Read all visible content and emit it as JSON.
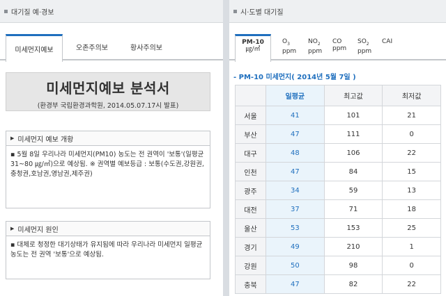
{
  "left": {
    "section_title": "대기질 예·경보",
    "tabs": [
      {
        "label": "미세먼지예보"
      },
      {
        "label": "오존주의보"
      },
      {
        "label": "황사주의보"
      }
    ],
    "report_title": "미세먼지예보 분석서",
    "report_subtitle": "(환경부 국립환경과학원, 2014.05.07.17시 발표)",
    "overview": {
      "heading": "미세먼지 예보 개황",
      "text": "▪ 5월 8일 우리나라 미세먼지(PM10) 농도는 전 권역이 '보통'(일평균 31~80 ㎍/㎥)으로 예상됨. ※ 권역별 예보등급 : 보통(수도권,강원권,충청권,호남권,영남권,제주권)"
    },
    "cause": {
      "heading": "미세먼지 원인",
      "text": "▪ 대체로 청정한 대기상태가 유지됨에 따라 우리나라 미세먼지 일평균 농도는 전 권역 '보통'으로 예상됨."
    }
  },
  "right": {
    "section_title": "시·도별 대기질",
    "tabs": [
      {
        "top": "PM-10",
        "bottom": "㎍/㎥",
        "sub": ""
      },
      {
        "top": "O",
        "sub": "3",
        "bottom": "ppm"
      },
      {
        "top": "NO",
        "sub": "2",
        "bottom": "ppm"
      },
      {
        "top": "CO",
        "sub": "",
        "bottom": "ppm"
      },
      {
        "top": "SO",
        "sub": "2",
        "bottom": "ppm"
      },
      {
        "top": "CAI",
        "sub": "",
        "bottom": ""
      }
    ],
    "date_line": "- PM-10 미세먼지( 2014년 5월 7일 )",
    "table": {
      "headers": [
        "",
        "일평균",
        "최고값",
        "최저값"
      ],
      "rows": [
        [
          "서울",
          "41",
          "101",
          "21"
        ],
        [
          "부산",
          "47",
          "111",
          "0"
        ],
        [
          "대구",
          "48",
          "106",
          "22"
        ],
        [
          "인천",
          "47",
          "84",
          "15"
        ],
        [
          "광주",
          "34",
          "59",
          "13"
        ],
        [
          "대전",
          "37",
          "71",
          "18"
        ],
        [
          "울산",
          "53",
          "153",
          "25"
        ],
        [
          "경기",
          "49",
          "210",
          "1"
        ],
        [
          "강원",
          "50",
          "98",
          "0"
        ],
        [
          "충북",
          "47",
          "82",
          "22"
        ]
      ]
    }
  },
  "colors": {
    "accent": "#1f6fbe",
    "header_bg": "#eef0f2",
    "avg_col_bg": "#eaf4fb"
  }
}
